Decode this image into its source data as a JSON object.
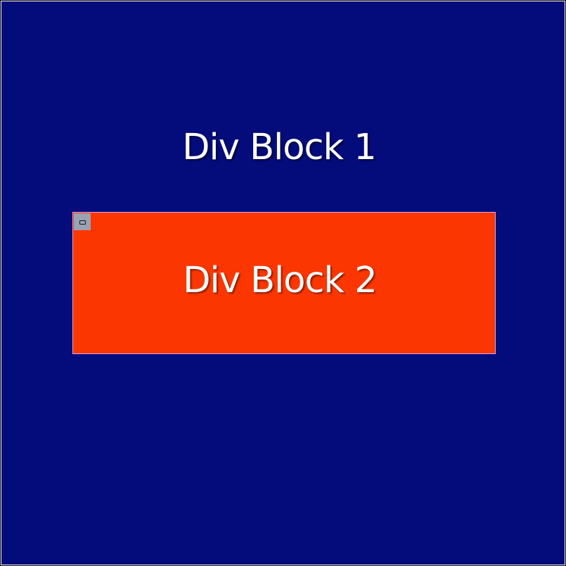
{
  "blocks": [
    {
      "label": "Div Block 1",
      "background_color": "#040b7b",
      "text_color": "#ffffff"
    },
    {
      "label": "Div Block 2",
      "background_color": "#fc3600",
      "border_color": "#d7a8e8",
      "text_color": "#ffffff",
      "handle_icon": "window-icon"
    }
  ]
}
